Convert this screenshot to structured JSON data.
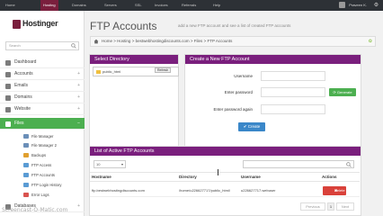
{
  "colors": {
    "topbar": "#2d3136",
    "brand": "#7a1f3d",
    "panel_header": "#7a1f7d",
    "active_green": "#4caf50",
    "primary_blue": "#3a87c9",
    "danger_red": "#d9413a"
  },
  "topnav": {
    "items": [
      "Home",
      "Hosting",
      "Domains",
      "Servers",
      "SSL",
      "Invoices",
      "Referrals",
      "Help"
    ],
    "active": "Hosting",
    "user_name": "Praveen K."
  },
  "sidebar": {
    "logo_text": "Hostinger",
    "search_placeholder": "Search",
    "items": [
      {
        "label": "Dashboard",
        "icon": "dashboard-icon"
      },
      {
        "label": "Accounts",
        "icon": "accounts-icon"
      },
      {
        "label": "Emails",
        "icon": "email-icon"
      },
      {
        "label": "Domains",
        "icon": "domains-icon"
      },
      {
        "label": "Website",
        "icon": "website-icon"
      },
      {
        "label": "Files",
        "icon": "files-icon"
      }
    ],
    "files_subitems": [
      {
        "label": "File Manager",
        "icon": "file-manager-icon"
      },
      {
        "label": "File Manager 2",
        "icon": "file-manager-2-icon"
      },
      {
        "label": "Backups",
        "icon": "backups-icon"
      },
      {
        "label": "FTP Access",
        "icon": "ftp-access-icon"
      },
      {
        "label": "FTP Accounts",
        "icon": "ftp-accounts-icon"
      },
      {
        "label": "FTP Login History",
        "icon": "ftp-history-icon"
      },
      {
        "label": "Error Logs",
        "icon": "error-logs-icon"
      }
    ],
    "databases_label": "Databases"
  },
  "page": {
    "title": "FTP Accounts",
    "subtitle": "add a new FTP account and see a list of created FTP accounts",
    "breadcrumb": [
      "Home",
      "Hosting",
      "bestwebhostingdiscounts.com",
      "Files",
      "FTP Accounts"
    ]
  },
  "select_directory": {
    "title": "Select Directory",
    "folder": "public_html",
    "refresh_label": "Refresh"
  },
  "create_account": {
    "title": "Create a New FTP Account",
    "username_label": "Username",
    "password_label": "Enter password",
    "password_again_label": "Enter password again",
    "generate_label": "Generate",
    "create_label": "Create"
  },
  "accounts_list": {
    "title": "List of Active FTP Accounts",
    "per_page": "10",
    "columns": [
      "Hostname",
      "Directory",
      "Username",
      "Actions"
    ],
    "rows": [
      {
        "hostname": "ftp.bestwebhostingdiscounts.com",
        "directory": "/home/u226627717/public_html/",
        "username": "u226627717.webuser",
        "action": "Delete"
      }
    ],
    "pager": {
      "previous": "Previous",
      "page": "1",
      "next": "Next"
    }
  },
  "watermark": "Screencast-O-Matic.com"
}
